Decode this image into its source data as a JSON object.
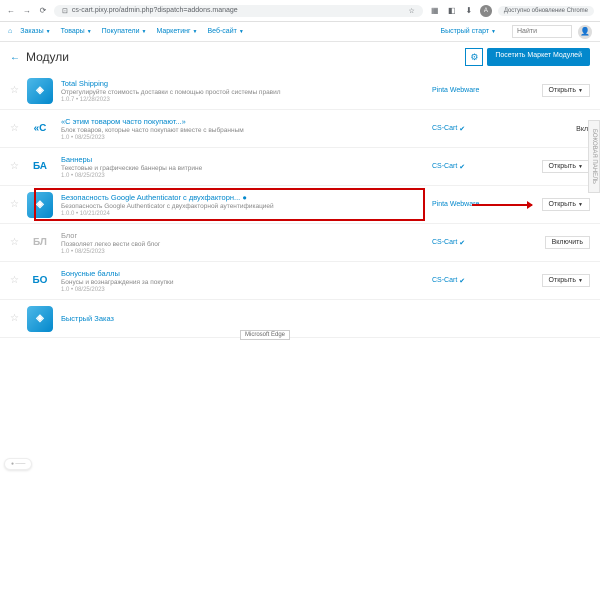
{
  "browser": {
    "url": "cs-cart.pixy.pro/admin.php?dispatch=addons.manage",
    "update_text": "Доступно обновление Chrome"
  },
  "nav": {
    "items": [
      "Заказы",
      "Товары",
      "Покупатели",
      "Маркетинг",
      "Веб-сайт"
    ],
    "quick_start": "Быстрый старт",
    "search_placeholder": "Найти"
  },
  "page": {
    "title": "Модули",
    "market_btn": "Посетить Маркет Модулей"
  },
  "addons": [
    {
      "icon_type": "blue-img",
      "icon": "",
      "name": "Total Shipping",
      "desc": "Отрегулируйте стоимость доставки с помощью простой системы правил",
      "ver": "1.0.7 • 12/28/2023",
      "vendor": "Pinta Webware",
      "vendor_check": false,
      "action": "open"
    },
    {
      "icon_type": "text",
      "icon": "«С",
      "name": "«С этим товаром часто покупают...»",
      "desc": "Блок товаров, которые часто покупают вместе с выбранным",
      "ver": "1.0 • 08/25/2023",
      "vendor": "CS-Cart",
      "vendor_check": true,
      "action": "on"
    },
    {
      "icon_type": "text",
      "icon": "БА",
      "name": "Баннеры",
      "desc": "Текстовые и графические баннеры на витрине",
      "ver": "1.0 • 08/25/2023",
      "vendor": "CS-Cart",
      "vendor_check": true,
      "action": "open"
    },
    {
      "icon_type": "blue-img",
      "icon": "",
      "name": "Безопасность Google Authenticator с двухфакторн... ●",
      "desc": "Безопасность Google Authenticator с двухфакторной аутентификацией",
      "ver": "1.0.0 • 10/21/2024",
      "vendor": "Pinta Webware",
      "vendor_check": false,
      "action": "open",
      "highlight": true
    },
    {
      "icon_type": "grey",
      "icon": "БЛ",
      "name": "Блог",
      "desc": "Позволяет легко вести свой блог",
      "ver": "1.0 • 08/25/2023",
      "vendor": "CS-Cart",
      "vendor_check": true,
      "action": "enable",
      "grey": true
    },
    {
      "icon_type": "text",
      "icon": "БО",
      "name": "Бонусные баллы",
      "desc": "Бонусы и вознаграждения за покупки",
      "ver": "1.0 • 08/25/2023",
      "vendor": "CS-Cart",
      "vendor_check": true,
      "action": "open"
    },
    {
      "icon_type": "blue-img",
      "icon": "",
      "name": "Быстрый Заказ",
      "desc": "",
      "ver": "",
      "vendor": "",
      "vendor_check": false,
      "action": ""
    }
  ],
  "labels": {
    "open": "Открыть",
    "enable": "Включить",
    "on": "Вкл.",
    "side_panel": "БОКОВАЯ ПАНЕЛЬ",
    "edge": "Microsoft Edge"
  }
}
